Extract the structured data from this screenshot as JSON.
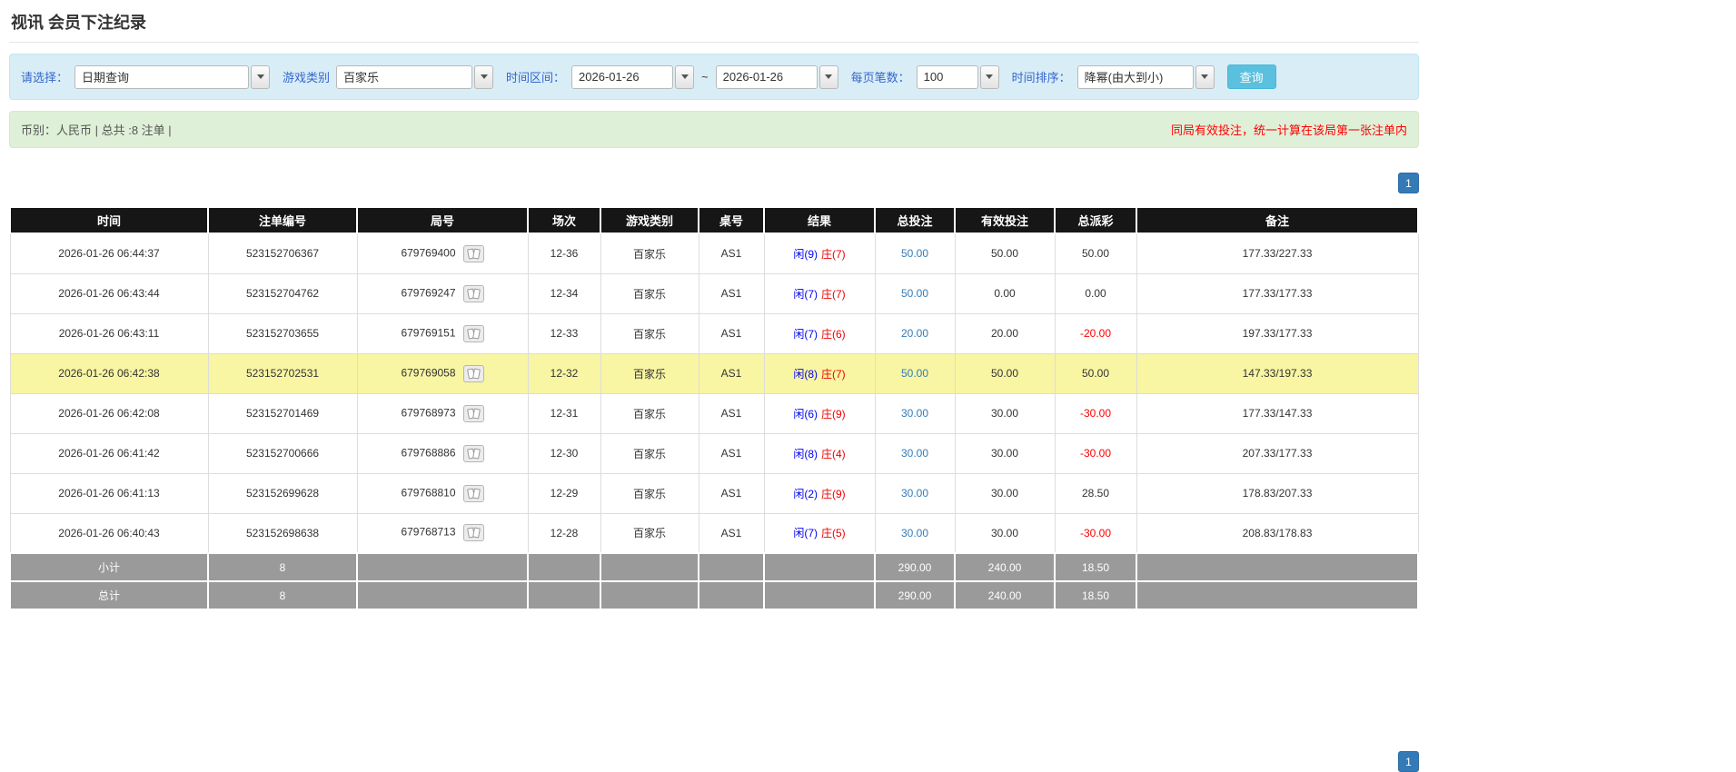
{
  "page": {
    "title": "视讯 会员下注纪录"
  },
  "colors": {
    "accent_blue": "#337ab7",
    "label_blue": "#3366cc",
    "info_bg": "#d9edf7",
    "info_border": "#bce8f1",
    "success_bg": "#dff0d8",
    "success_border": "#d6e9c6",
    "btn_info": "#5bc0de",
    "btn_info_border": "#46b8da",
    "header_bg": "#161616",
    "summary_gray": "#9a9a9a",
    "highlight_row": "#f8f5a3",
    "player_blue": "#0000ee",
    "banker_red": "#ee0000",
    "negative_red": "#ff0000"
  },
  "filters": {
    "select_label": "请选择：",
    "select_value": "日期查询",
    "game_label": "游戏类别",
    "game_value": "百家乐",
    "range_label": "时间区间：",
    "range_from": "2026-01-26",
    "range_sep": "~",
    "range_to": "2026-01-26",
    "pagesize_label": "每页笔数：",
    "pagesize_value": "100",
    "sort_label": "时间排序：",
    "sort_value": "降幂(由大到小)",
    "search_button": "查询"
  },
  "summary": {
    "left": "币别：人民币 | 总共 :8 注单 |",
    "right": "同局有效投注，统一计算在该局第一张注单内"
  },
  "pagination": {
    "page": "1"
  },
  "table": {
    "headers": [
      "时间",
      "注单编号",
      "局号",
      "场次",
      "游戏类别",
      "桌号",
      "结果",
      "总投注",
      "有效投注",
      "总派彩",
      "备注"
    ],
    "rows": [
      {
        "time": "2026-01-26 06:44:37",
        "bet_id": "523152706367",
        "round_id": "679769400",
        "session": "12-36",
        "game": "百家乐",
        "table_no": "AS1",
        "result_player": "闲(9)",
        "result_banker": "庄(7)",
        "total_bet": "50.00",
        "valid_bet": "50.00",
        "payout": "50.00",
        "note": "177.33/227.33",
        "highlighted": false
      },
      {
        "time": "2026-01-26 06:43:44",
        "bet_id": "523152704762",
        "round_id": "679769247",
        "session": "12-34",
        "game": "百家乐",
        "table_no": "AS1",
        "result_player": "闲(7)",
        "result_banker": "庄(7)",
        "total_bet": "50.00",
        "valid_bet": "0.00",
        "payout": "0.00",
        "note": "177.33/177.33",
        "highlighted": false
      },
      {
        "time": "2026-01-26 06:43:11",
        "bet_id": "523152703655",
        "round_id": "679769151",
        "session": "12-33",
        "game": "百家乐",
        "table_no": "AS1",
        "result_player": "闲(7)",
        "result_banker": "庄(6)",
        "total_bet": "20.00",
        "valid_bet": "20.00",
        "payout": "-20.00",
        "note": "197.33/177.33",
        "highlighted": false
      },
      {
        "time": "2026-01-26 06:42:38",
        "bet_id": "523152702531",
        "round_id": "679769058",
        "session": "12-32",
        "game": "百家乐",
        "table_no": "AS1",
        "result_player": "闲(8)",
        "result_banker": "庄(7)",
        "total_bet": "50.00",
        "valid_bet": "50.00",
        "payout": "50.00",
        "note": "147.33/197.33",
        "highlighted": true
      },
      {
        "time": "2026-01-26 06:42:08",
        "bet_id": "523152701469",
        "round_id": "679768973",
        "session": "12-31",
        "game": "百家乐",
        "table_no": "AS1",
        "result_player": "闲(6)",
        "result_banker": "庄(9)",
        "total_bet": "30.00",
        "valid_bet": "30.00",
        "payout": "-30.00",
        "note": "177.33/147.33",
        "highlighted": false
      },
      {
        "time": "2026-01-26 06:41:42",
        "bet_id": "523152700666",
        "round_id": "679768886",
        "session": "12-30",
        "game": "百家乐",
        "table_no": "AS1",
        "result_player": "闲(8)",
        "result_banker": "庄(4)",
        "total_bet": "30.00",
        "valid_bet": "30.00",
        "payout": "-30.00",
        "note": "207.33/177.33",
        "highlighted": false
      },
      {
        "time": "2026-01-26 06:41:13",
        "bet_id": "523152699628",
        "round_id": "679768810",
        "session": "12-29",
        "game": "百家乐",
        "table_no": "AS1",
        "result_player": "闲(2)",
        "result_banker": "庄(9)",
        "total_bet": "30.00",
        "valid_bet": "30.00",
        "payout": "28.50",
        "note": "178.83/207.33",
        "highlighted": false
      },
      {
        "time": "2026-01-26 06:40:43",
        "bet_id": "523152698638",
        "round_id": "679768713",
        "session": "12-28",
        "game": "百家乐",
        "table_no": "AS1",
        "result_player": "闲(7)",
        "result_banker": "庄(5)",
        "total_bet": "30.00",
        "valid_bet": "30.00",
        "payout": "-30.00",
        "note": "208.83/178.83",
        "highlighted": false
      }
    ],
    "subtotal": {
      "label": "小计",
      "count": "8",
      "total_bet": "290.00",
      "valid_bet": "240.00",
      "payout": "18.50"
    },
    "total": {
      "label": "总计",
      "count": "8",
      "total_bet": "290.00",
      "valid_bet": "240.00",
      "payout": "18.50"
    }
  }
}
